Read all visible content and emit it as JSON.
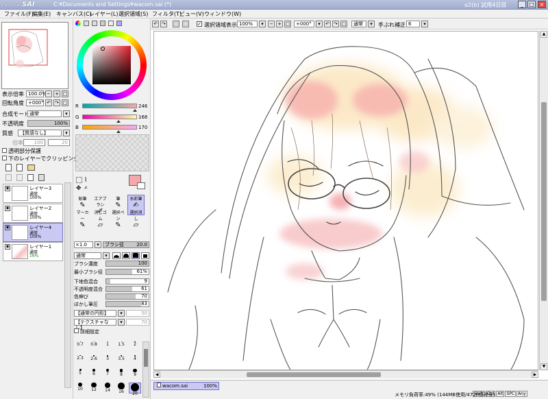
{
  "window": {
    "logo_small": "PaintTool",
    "logo": "SAI",
    "path": "C:¥Documents and Settings¥wacom.sai (*)",
    "trial": "α2(b) 試用4日目",
    "minimize": "_",
    "maximize": "□",
    "close": "×"
  },
  "menu": [
    "ファイル(F)",
    "編集(E)",
    "キャンバス(C)",
    "レイヤー(L)",
    "選択領域(S)",
    "フィルタ(T)",
    "ビュー(V)",
    "ウィンドウ(W)"
  ],
  "navigator": {
    "zoom_label": "表示倍率",
    "zoom_value": "100.0%",
    "angle_label": "回転角度",
    "angle_value": "+000°"
  },
  "layer_props": {
    "blend_label": "合成モード",
    "blend_value": "通常",
    "opacity_label": "不透明度",
    "opacity_value": "100%",
    "texture_label": "質感",
    "texture_value": "【質感なし】",
    "scale_label": "倍率",
    "scale_value": "100",
    "strength_value": "20",
    "preserve_opacity": "透明部分保護",
    "clip_group": "下のレイヤーでクリッピング"
  },
  "layers": [
    {
      "name": "レイヤー3",
      "mode": "通常",
      "opacity": "100%",
      "selected": false
    },
    {
      "name": "レイヤー2",
      "mode": "通常",
      "opacity": "100%",
      "selected": false
    },
    {
      "name": "レイヤー4",
      "mode": "通常",
      "opacity": "100%",
      "selected": true
    },
    {
      "name": "レイヤー1",
      "mode": "通常",
      "opacity": "16%",
      "selected": false
    }
  ],
  "color": {
    "r_label": "R",
    "r_value": "246",
    "r_frac": 0.965,
    "g_label": "G",
    "g_value": "168",
    "g_frac": 0.659,
    "b_label": "B",
    "b_value": "170",
    "b_frac": 0.667,
    "current": "#f6a8aa"
  },
  "tools": [
    {
      "label": "鉛筆",
      "selected": false
    },
    {
      "label": "エアブラシ",
      "selected": false
    },
    {
      "label": "筆",
      "selected": false
    },
    {
      "label": "水彩筆",
      "selected": true
    },
    {
      "label": "マーカー",
      "selected": false
    },
    {
      "label": "消しゴム",
      "selected": false
    },
    {
      "label": "選択ペン",
      "selected": false
    },
    {
      "label": "選択消し",
      "selected": false
    }
  ],
  "brush": {
    "size_mult": "×1.0",
    "size_label": "ブラシ径",
    "size_value": "20.0",
    "blend_mode": "通常",
    "density_label": "ブラシ濃度",
    "density_value": "100",
    "min_size_label": "最小ブラシ径",
    "min_size_value": "61%",
    "blending_label": "下地色混合",
    "blending_value": "9",
    "dilution_label": "不透明度混合",
    "dilution_value": "61",
    "persistence_label": "色伸び",
    "persistence_value": "70",
    "blur_label": "ぼかし筆圧",
    "blur_value": "83",
    "shape_label": "【通常の円形】",
    "shape_value": "50",
    "texture_label": "【テクスチャなし】",
    "texture_value": "70",
    "advanced_label": "詳細設定",
    "presets": [
      "0.7",
      "0.8",
      "1",
      "1.5",
      "2",
      "2.3",
      "2.6",
      "3",
      "3.5",
      "4",
      "5",
      "6",
      "7",
      "8",
      "9",
      "10",
      "12",
      "14",
      "16",
      "20"
    ]
  },
  "canvas_toolbar": {
    "show_selection": "選択領域表示",
    "zoom": "100%",
    "angle": "+000°",
    "mode": "通常",
    "stabilizer_label": "手ぶれ補正",
    "stabilizer_value": "6"
  },
  "status": {
    "tab_name": "wacom.sai",
    "tab_zoom": "100%",
    "memory": "メモリ負荷率:49% (144MB使用/472MB確保)",
    "keys": [
      "Shift",
      "Ctrl",
      "Alt",
      "SPC",
      "Any"
    ]
  }
}
